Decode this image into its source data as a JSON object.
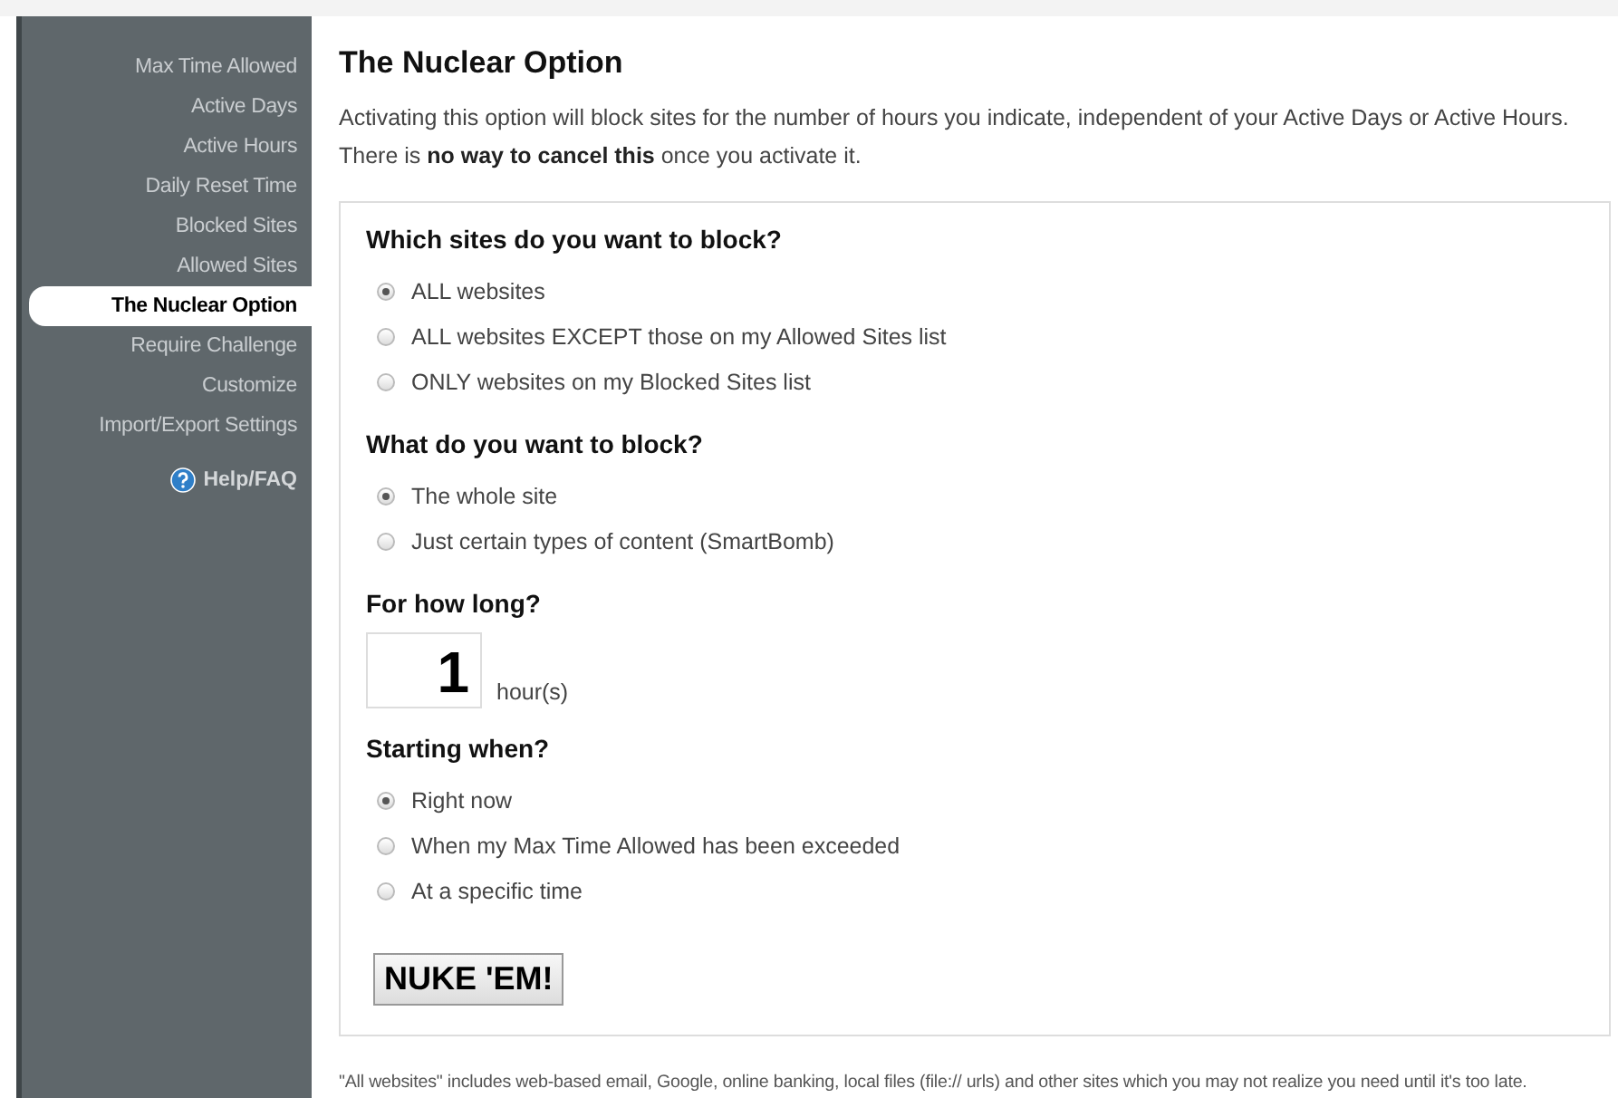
{
  "sidebar": {
    "items": [
      {
        "label": "Max Time Allowed",
        "selected": false
      },
      {
        "label": "Active Days",
        "selected": false
      },
      {
        "label": "Active Hours",
        "selected": false
      },
      {
        "label": "Daily Reset Time",
        "selected": false
      },
      {
        "label": "Blocked Sites",
        "selected": false
      },
      {
        "label": "Allowed Sites",
        "selected": false
      },
      {
        "label": "The Nuclear Option",
        "selected": true
      },
      {
        "label": "Require Challenge",
        "selected": false
      },
      {
        "label": "Customize",
        "selected": false
      },
      {
        "label": "Import/Export Settings",
        "selected": false
      }
    ],
    "help_link": "Help/FAQ"
  },
  "page": {
    "title": "The Nuclear Option",
    "intro": "Activating this option will block sites for the number of hours you indicate, independent of your Active Days or Active Hours. There is **no way to cancel this** once you activate it.",
    "sections": [
      {
        "kind": "radios",
        "heading": "Which sites do you want to block?",
        "options": [
          {
            "label": "ALL websites",
            "selected": true
          },
          {
            "label": "ALL websites EXCEPT those on my Allowed Sites list",
            "selected": false
          },
          {
            "label": "ONLY websites on my Blocked Sites list",
            "selected": false
          }
        ]
      },
      {
        "kind": "radios",
        "heading": "What do you want to block?",
        "options": [
          {
            "label": "The whole site",
            "selected": true
          },
          {
            "label": "Just certain types of content (SmartBomb)",
            "selected": false
          }
        ]
      },
      {
        "kind": "number",
        "heading": "For how long?",
        "value": "1",
        "unit": "hour(s)"
      },
      {
        "kind": "radios",
        "heading": "Starting when?",
        "options": [
          {
            "label": "Right now",
            "selected": true
          },
          {
            "label": "When my Max Time Allowed has been exceeded",
            "selected": false
          },
          {
            "label": "At a specific time",
            "selected": false
          }
        ]
      },
      {
        "kind": "button",
        "label": "NUKE 'EM!"
      }
    ],
    "footnote": "\"All websites\" includes web-based email, Google, online banking, local files (file:// urls) and other sites which you may not realize you need until it's too late."
  }
}
